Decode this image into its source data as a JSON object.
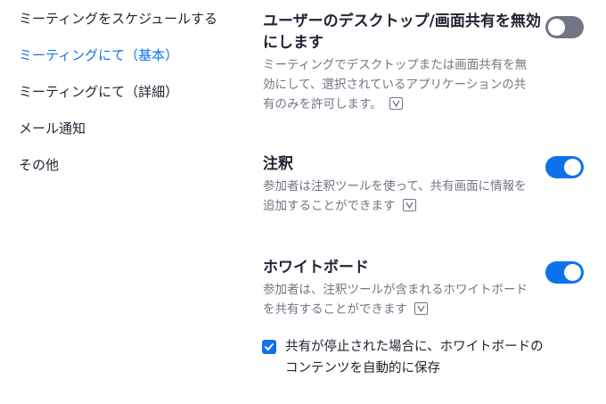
{
  "sidebar": {
    "items": [
      {
        "label": "ミーティングをスケジュールする",
        "active": false
      },
      {
        "label": "ミーティングにて（基本）",
        "active": true
      },
      {
        "label": "ミーティングにて（詳細）",
        "active": false
      },
      {
        "label": "メール通知",
        "active": false
      },
      {
        "label": "その他",
        "active": false
      }
    ]
  },
  "settings": [
    {
      "title": "ユーザーのデスクトップ/画面共有を無効にします",
      "description": "ミーティングでデスクトップまたは画面共有を無効にして、選択されているアプリケーションの共有のみを許可します。",
      "enabled": false
    },
    {
      "title": "注釈",
      "description": "参加者は注釈ツールを使って、共有画面に情報を追加することができます",
      "enabled": true
    },
    {
      "title": "ホワイトボード",
      "description": "参加者は、注釈ツールが含まれるホワイトボードを共有することができます",
      "enabled": true,
      "option": {
        "label": "共有が停止された場合に、ホワイトボードのコンテンツを自動的に保存",
        "checked": true
      }
    }
  ],
  "colors": {
    "accent": "#0e72ed",
    "toggle_off": "#747487",
    "text": "#232333",
    "muted": "#747487"
  },
  "icons": {
    "version_badge": "v-badge-icon",
    "check": "checkmark-icon"
  }
}
